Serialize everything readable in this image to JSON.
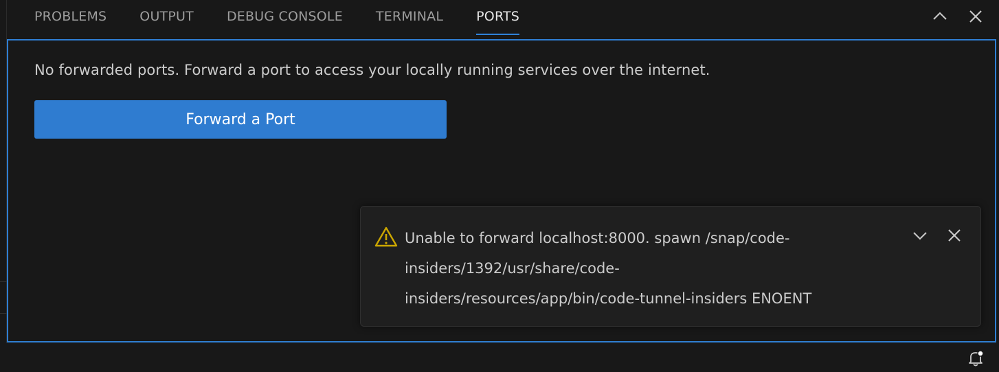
{
  "panel": {
    "tabs": [
      {
        "label": "PROBLEMS",
        "active": false
      },
      {
        "label": "OUTPUT",
        "active": false
      },
      {
        "label": "DEBUG CONSOLE",
        "active": false
      },
      {
        "label": "TERMINAL",
        "active": false
      },
      {
        "label": "PORTS",
        "active": true
      }
    ],
    "actions": {
      "maximize_icon": "chevron-up-icon",
      "close_icon": "close-icon"
    }
  },
  "ports": {
    "empty_message": "No forwarded ports. Forward a port to access your locally running services over the internet.",
    "forward_button_label": "Forward a Port"
  },
  "notification": {
    "severity_icon": "warning-icon",
    "lines": [
      "Unable to forward localhost:8000. spawn /snap/code-",
      "insiders/1392/usr/share/code-",
      "insiders/resources/app/bin/code-tunnel-insiders ENOENT"
    ],
    "collapse_icon": "chevron-down-icon",
    "close_icon": "close-icon"
  },
  "status_bar": {
    "notifications_icon": "bell-dot-icon"
  },
  "colors": {
    "background": "#181818",
    "accent": "#2f7cd0",
    "focus_border": "#2f7fd3",
    "warning": "#cca700",
    "text": "#cccccc"
  }
}
